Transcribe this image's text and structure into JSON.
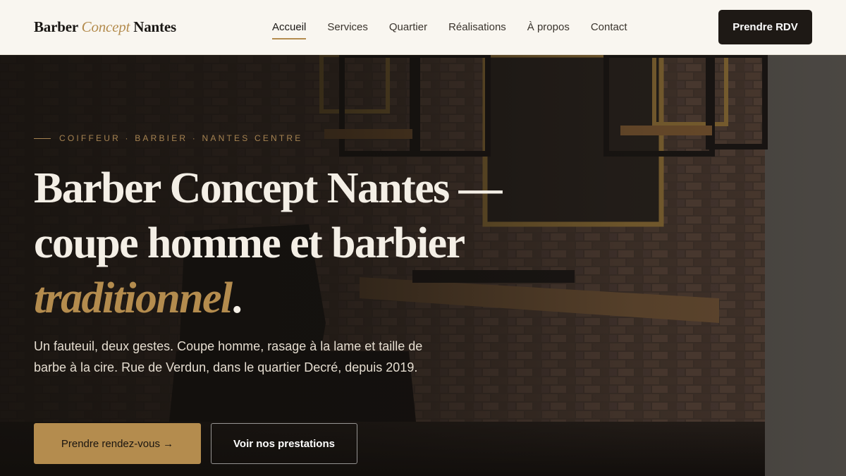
{
  "header": {
    "logo": {
      "part1": "Barber",
      "part2": "Concept",
      "part3": "Nantes"
    },
    "nav": [
      {
        "label": "Accueil",
        "active": true
      },
      {
        "label": "Services",
        "active": false
      },
      {
        "label": "Quartier",
        "active": false
      },
      {
        "label": "Réalisations",
        "active": false
      },
      {
        "label": "À propos",
        "active": false
      },
      {
        "label": "Contact",
        "active": false
      }
    ],
    "cta_label": "Prendre RDV"
  },
  "hero": {
    "eyebrow": "COIFFEUR · BARBIER · NANTES CENTRE",
    "headline": {
      "line1": "Barber Concept Nantes —",
      "line2": "coupe homme et barbier",
      "line3_accent": "traditionnel",
      "line3_end": "."
    },
    "lede": "Un fauteuil, deux gestes. Coupe homme, rasage à la lame et taille de barbe à la cire. Rue de Verdun, dans le quartier Decré, depuis 2019.",
    "primary_cta": "Prendre rendez-vous →",
    "secondary_cta": "Voir nos prestations"
  },
  "colors": {
    "accent": "#b48c4e",
    "header_bg": "#f9f6f0",
    "dark": "#1e1915",
    "hero_text": "#f4efe6"
  }
}
